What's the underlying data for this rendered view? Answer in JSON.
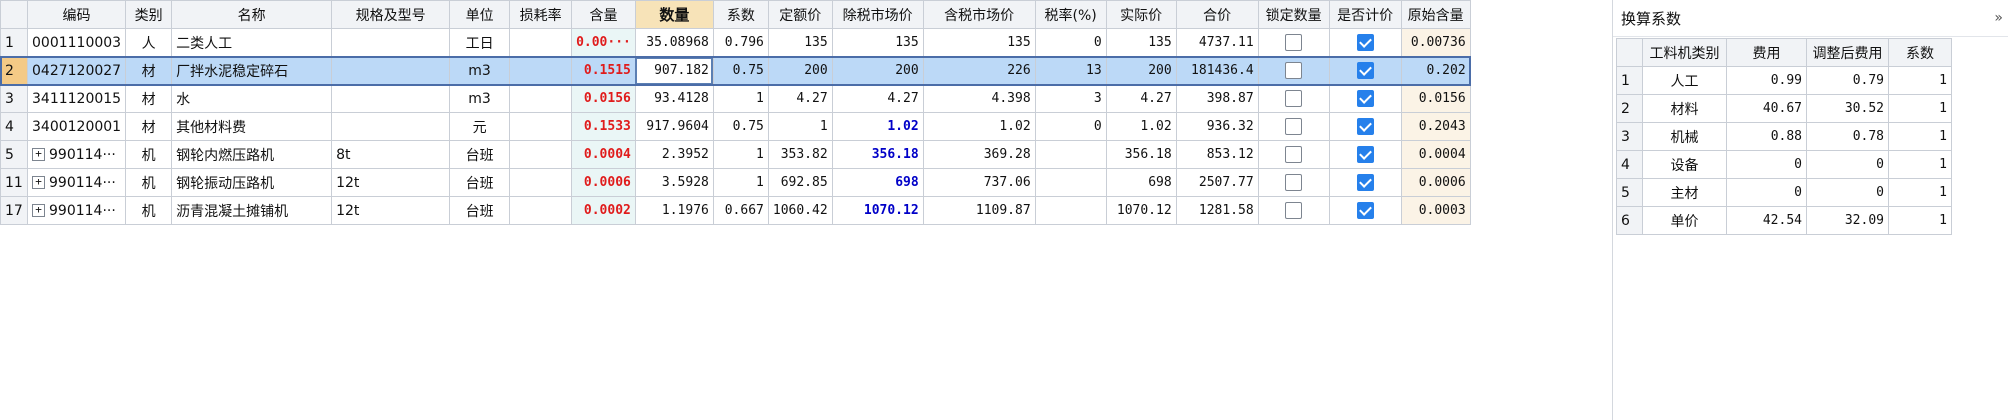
{
  "main_table": {
    "headers": {
      "code": "编码",
      "type": "类别",
      "name": "名称",
      "spec": "规格及型号",
      "unit": "单位",
      "loss": "损耗率",
      "content": "含量",
      "qty": "数量",
      "coef": "系数",
      "quota": "定额价",
      "market_ex": "除税市场价",
      "market_in": "含税市场价",
      "tax": "税率(%)",
      "actual": "实际价",
      "total": "合价",
      "lock": "锁定数量",
      "priced": "是否计价",
      "orig": "原始含量"
    },
    "rows": [
      {
        "num": "1",
        "expand": "",
        "code": "0001110003",
        "type": "人",
        "name": "二类人工",
        "spec": "",
        "unit": "工日",
        "loss": "",
        "content": "0.00···",
        "qty": "35.08968",
        "coef": "0.796",
        "quota": "135",
        "market_ex": "135",
        "market_ex_blue": false,
        "market_in": "135",
        "tax": "0",
        "actual": "135",
        "total": "4737.11",
        "lock": false,
        "priced": true,
        "orig": "0.00736"
      },
      {
        "num": "2",
        "expand": "",
        "code": "0427120027",
        "type": "材",
        "name": "厂拌水泥稳定碎石",
        "spec": "",
        "unit": "m3",
        "loss": "",
        "content": "0.1515",
        "qty": "907.182",
        "coef": "0.75",
        "quota": "200",
        "market_ex": "200",
        "market_ex_blue": false,
        "market_in": "226",
        "tax": "13",
        "actual": "200",
        "total": "181436.4",
        "lock": false,
        "priced": true,
        "orig": "0.202"
      },
      {
        "num": "3",
        "expand": "",
        "code": "3411120015",
        "type": "材",
        "name": "水",
        "spec": "",
        "unit": "m3",
        "loss": "",
        "content": "0.0156",
        "qty": "93.4128",
        "coef": "1",
        "quota": "4.27",
        "market_ex": "4.27",
        "market_ex_blue": false,
        "market_in": "4.398",
        "tax": "3",
        "actual": "4.27",
        "total": "398.87",
        "lock": false,
        "priced": true,
        "orig": "0.0156"
      },
      {
        "num": "4",
        "expand": "",
        "code": "3400120001",
        "type": "材",
        "name": "其他材料费",
        "spec": "",
        "unit": "元",
        "loss": "",
        "content": "0.1533",
        "qty": "917.9604",
        "coef": "0.75",
        "quota": "1",
        "market_ex": "1.02",
        "market_ex_blue": true,
        "market_in": "1.02",
        "tax": "0",
        "actual": "1.02",
        "total": "936.32",
        "lock": false,
        "priced": true,
        "orig": "0.2043"
      },
      {
        "num": "5",
        "expand": "+",
        "code": "990114···",
        "type": "机",
        "name": "钢轮内燃压路机",
        "spec": "8t",
        "unit": "台班",
        "loss": "",
        "content": "0.0004",
        "qty": "2.3952",
        "coef": "1",
        "quota": "353.82",
        "market_ex": "356.18",
        "market_ex_blue": true,
        "market_in": "369.28",
        "tax": "",
        "actual": "356.18",
        "total": "853.12",
        "lock": false,
        "priced": true,
        "orig": "0.0004"
      },
      {
        "num": "11",
        "expand": "+",
        "code": "990114···",
        "type": "机",
        "name": "钢轮振动压路机",
        "spec": "12t",
        "unit": "台班",
        "loss": "",
        "content": "0.0006",
        "qty": "3.5928",
        "coef": "1",
        "quota": "692.85",
        "market_ex": "698",
        "market_ex_blue": true,
        "market_in": "737.06",
        "tax": "",
        "actual": "698",
        "total": "2507.77",
        "lock": false,
        "priced": true,
        "orig": "0.0006"
      },
      {
        "num": "17",
        "expand": "+",
        "code": "990114···",
        "type": "机",
        "name": "沥青混凝土摊铺机",
        "spec": "12t",
        "unit": "台班",
        "loss": "",
        "content": "0.0002",
        "qty": "1.1976",
        "coef": "0.667",
        "quota": "1060.42",
        "market_ex": "1070.12",
        "market_ex_blue": true,
        "market_in": "1109.87",
        "tax": "",
        "actual": "1070.12",
        "total": "1281.58",
        "lock": false,
        "priced": true,
        "orig": "0.0003"
      }
    ],
    "selected_row": 1
  },
  "side_panel": {
    "title": "换算系数",
    "collapse_icon": "double-chevron-right-icon",
    "headers": {
      "type": "工料机类别",
      "fee": "费用",
      "adj": "调整后费用",
      "coef": "系数"
    },
    "rows": [
      {
        "num": "1",
        "type": "人工",
        "fee": "0.99",
        "adj": "0.79",
        "coef": "1"
      },
      {
        "num": "2",
        "type": "材料",
        "fee": "40.67",
        "adj": "30.52",
        "coef": "1"
      },
      {
        "num": "3",
        "type": "机械",
        "fee": "0.88",
        "adj": "0.78",
        "coef": "1"
      },
      {
        "num": "4",
        "type": "设备",
        "fee": "0",
        "adj": "0",
        "coef": "1"
      },
      {
        "num": "5",
        "type": "主材",
        "fee": "0",
        "adj": "0",
        "coef": "1"
      },
      {
        "num": "6",
        "type": "单价",
        "fee": "42.54",
        "adj": "32.09",
        "coef": "1"
      }
    ]
  }
}
